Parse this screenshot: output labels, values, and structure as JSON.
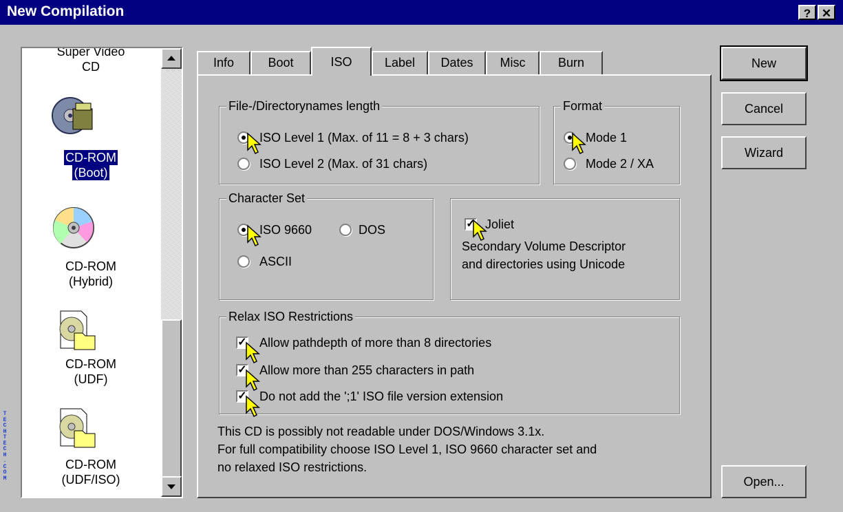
{
  "window": {
    "title": "New Compilation",
    "help_btn": "?",
    "close_btn": "✕"
  },
  "compilation_types": [
    {
      "line1": "Super Video",
      "line2": "CD",
      "icon": "super-video-cd-icon",
      "selected": false
    },
    {
      "line1": "CD-ROM",
      "line2": "(Boot)",
      "icon": "cd-rom-boot-icon",
      "selected": true
    },
    {
      "line1": "CD-ROM",
      "line2": "(Hybrid)",
      "icon": "cd-rom-hybrid-icon",
      "selected": false
    },
    {
      "line1": "CD-ROM",
      "line2": "(UDF)",
      "icon": "cd-rom-udf-icon",
      "selected": false
    },
    {
      "line1": "CD-ROM",
      "line2": "(UDF/ISO)",
      "icon": "cd-rom-udf-iso-icon",
      "selected": false
    }
  ],
  "tabs": [
    "Info",
    "Boot",
    "ISO",
    "Label",
    "Dates",
    "Misc",
    "Burn"
  ],
  "active_tab": "ISO",
  "iso": {
    "filenames_group": "File-/Directorynames length",
    "level1": "ISO Level 1 (Max. of 11 = 8 + 3 chars)",
    "level2": "ISO Level 2 (Max. of 31 chars)",
    "level_selected": "level1",
    "format_group": "Format",
    "mode1": "Mode 1",
    "mode2": "Mode 2 / XA",
    "format_selected": "mode1",
    "charset_group": "Character Set",
    "iso9660": "ISO 9660",
    "dos": "DOS",
    "ascii": "ASCII",
    "charset_selected": "iso9660",
    "joliet": "Joliet",
    "joliet_checked": true,
    "joliet_desc1": "Secondary Volume Descriptor",
    "joliet_desc2": "and directories using Unicode",
    "relax_group": "Relax ISO Restrictions",
    "relax1": "Allow pathdepth of more than 8 directories",
    "relax2": "Allow more than 255 characters in path",
    "relax3": "Do not add the ';1' ISO file version extension",
    "note1": "This CD is possibly not readable under DOS/Windows 3.1x.",
    "note2": "For full compatibility choose ISO Level 1, ISO 9660 character set and",
    "note3": "no relaxed ISO restrictions."
  },
  "buttons": {
    "new": "New",
    "cancel": "Cancel",
    "wizard": "Wizard",
    "open": "Open..."
  },
  "watermark": "TECHTECH.COM",
  "colors": {
    "titlebar": "#000080",
    "face": "#c0c0c0",
    "selection": "#000080",
    "cursor": "#ffff00"
  }
}
